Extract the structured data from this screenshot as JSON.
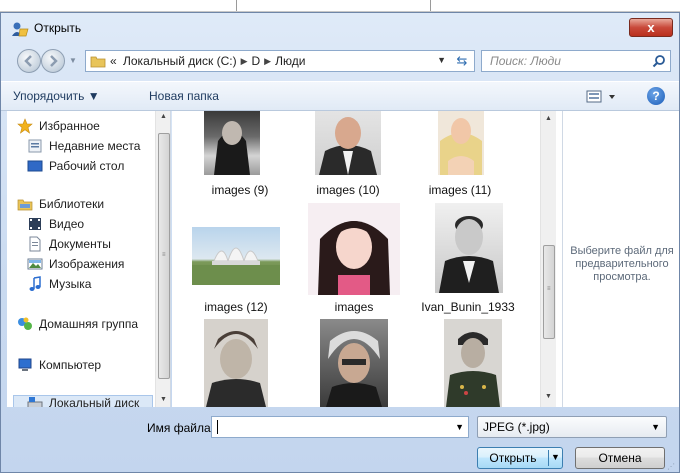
{
  "window": {
    "title": "Открыть",
    "close_label": "x"
  },
  "nav": {
    "chevron": "«",
    "breadcrumbs": [
      "Локальный диск (C:)",
      "D",
      "Люди"
    ],
    "search_placeholder": "Поиск: Люди"
  },
  "toolbar": {
    "organize_label": "Упорядочить ▼",
    "new_folder_label": "Новая папка",
    "help_label": "?"
  },
  "sidebar": {
    "items": [
      {
        "label": "Избранное",
        "icon": "star-icon"
      },
      {
        "label": "Недавние места",
        "icon": "recent-places-icon"
      },
      {
        "label": "Рабочий стол",
        "icon": "desktop-icon"
      },
      {
        "label": "Библиотеки",
        "icon": "libraries-icon"
      },
      {
        "label": "Видео",
        "icon": "video-icon"
      },
      {
        "label": "Документы",
        "icon": "documents-icon"
      },
      {
        "label": "Изображения",
        "icon": "pictures-icon"
      },
      {
        "label": "Музыка",
        "icon": "music-icon"
      },
      {
        "label": "Домашняя группа",
        "icon": "homegroup-icon"
      },
      {
        "label": "Компьютер",
        "icon": "computer-icon"
      },
      {
        "label": "Локальный диск",
        "icon": "drive-icon"
      }
    ]
  },
  "files": [
    {
      "name": "images (9)"
    },
    {
      "name": "images (10)"
    },
    {
      "name": "images (11)"
    },
    {
      "name": "images (12)"
    },
    {
      "name": "images"
    },
    {
      "name": "Ivan_Bunin_1933"
    },
    {
      "name": ""
    },
    {
      "name": ""
    },
    {
      "name": ""
    }
  ],
  "preview": {
    "message": "Выберите файл для предварительного просмотра."
  },
  "bottom": {
    "filename_label": "Имя файла:",
    "filename_value": "",
    "filetype_value": "JPEG (*.jpg)",
    "open_label": "Открыть",
    "cancel_label": "Отмена"
  }
}
